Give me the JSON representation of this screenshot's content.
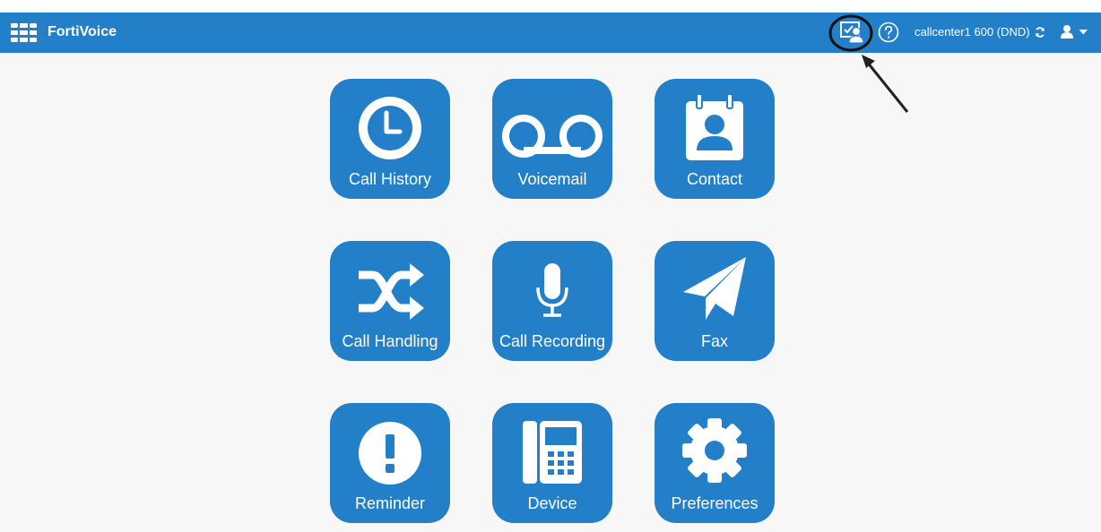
{
  "header": {
    "brand": "FortiVoice",
    "user_text": "callcenter1 600  (DND)",
    "icons": [
      "fortinet-logo-icon",
      "agent-console-icon",
      "help-icon",
      "refresh-icon",
      "user-icon",
      "caret-down-icon"
    ]
  },
  "tiles": [
    {
      "label": "Call History",
      "icon": "clock-icon"
    },
    {
      "label": "Voicemail",
      "icon": "voicemail-icon"
    },
    {
      "label": "Contact",
      "icon": "contact-card-icon"
    },
    {
      "label": "Call Handling",
      "icon": "shuffle-icon"
    },
    {
      "label": "Call Recording",
      "icon": "microphone-icon"
    },
    {
      "label": "Fax",
      "icon": "paper-plane-icon"
    },
    {
      "label": "Reminder",
      "icon": "exclamation-icon"
    },
    {
      "label": "Device",
      "icon": "desk-phone-icon"
    },
    {
      "label": "Preferences",
      "icon": "gear-icon"
    }
  ],
  "colors": {
    "accent": "#2380c8",
    "background": "#f7f7f7",
    "text_on_accent": "#ffffff",
    "annotation": "#111111"
  }
}
